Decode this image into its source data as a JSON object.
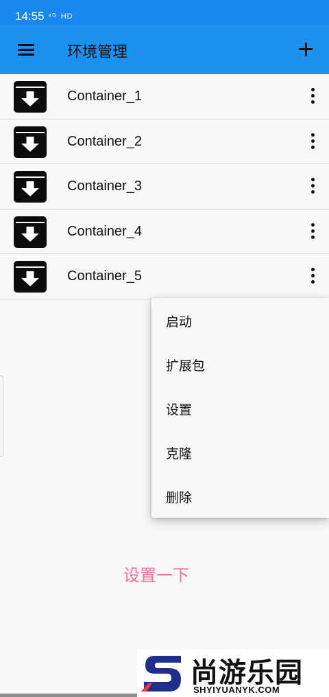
{
  "status_bar": {
    "time": "14:55",
    "signal": "⁴ᴳ",
    "hd": "HD"
  },
  "app_bar": {
    "title": "环境管理",
    "menu_icon": "hamburger-menu-icon",
    "add_icon": "plus-icon"
  },
  "containers": [
    {
      "name": "Container_1",
      "icon": "archive-download-icon"
    },
    {
      "name": "Container_2",
      "icon": "archive-download-icon"
    },
    {
      "name": "Container_3",
      "icon": "archive-download-icon"
    },
    {
      "name": "Container_4",
      "icon": "archive-download-icon"
    },
    {
      "name": "Container_5",
      "icon": "archive-download-icon"
    }
  ],
  "context_menu": {
    "items": [
      "启动",
      "扩展包",
      "设置",
      "克隆",
      "删除"
    ]
  },
  "hint_text": "设置一下",
  "watermark": {
    "cn": "尚游乐园",
    "en": "SHYIYUANYK.COM"
  },
  "colors": {
    "status_bar": "#1a86f0",
    "app_bar": "#1e91ee",
    "background": "#f7f8f7",
    "hint": "#e8739a",
    "icon": "#0c0c0c"
  }
}
